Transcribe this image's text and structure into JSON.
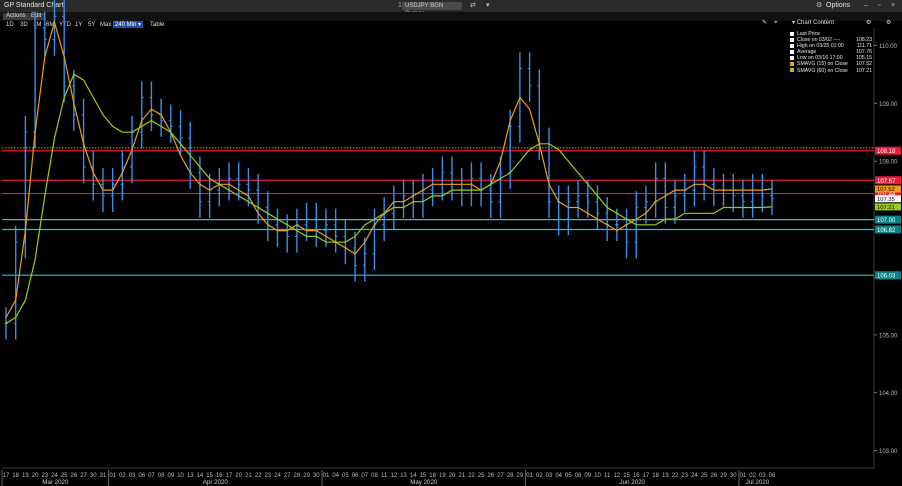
{
  "window": {
    "title": "GP Standard Chart",
    "security": "USDJPY BGN Curncy",
    "options_label": "Options",
    "window_icons": [
      "minimize-icon",
      "maximize-icon",
      "close-icon"
    ]
  },
  "toolbar": {
    "actions_label": "Actions",
    "edit_label": "Edit",
    "ranges": [
      "1D",
      "3D",
      "1M",
      "6M",
      "YTD",
      "1Y",
      "5Y",
      "Max"
    ],
    "active_range": "240 Min",
    "table_label": "Table",
    "chart_content_label": "Chart Content"
  },
  "legend": [
    {
      "label": "Last Price",
      "value": "",
      "color": "#ffffff"
    },
    {
      "label": "Close on 03/02 ----",
      "value": "108.23",
      "color": "#ffffff"
    },
    {
      "label": "High on 03/25 01:00",
      "value": "111.71",
      "color": "#ffffff"
    },
    {
      "label": "Average",
      "value": "107.76",
      "color": "#ffffff"
    },
    {
      "label": "Low on 03/16 17:00",
      "value": "105.15",
      "color": "#ffffff"
    },
    {
      "label": "SMAVG (15)  on Close",
      "value": "107.52",
      "color": "#f39c12"
    },
    {
      "label": "SMAVG (60)  on Close",
      "value": "107.21",
      "color": "#9ccc18"
    }
  ],
  "chart_data": {
    "type": "line",
    "ylim": [
      102.7,
      110.3
    ],
    "y_ticks": [
      "110.00",
      "109.00",
      "108.00",
      "107.00",
      "106.00",
      "105.00",
      "104.00",
      "103.00"
    ],
    "x_days": [
      "17",
      "18",
      "19",
      "20",
      "23",
      "24",
      "25",
      "26",
      "27",
      "30",
      "31",
      "01",
      "02",
      "03",
      "06",
      "07",
      "08",
      "09",
      "10",
      "13",
      "14",
      "15",
      "16",
      "17",
      "20",
      "21",
      "22",
      "23",
      "24",
      "27",
      "28",
      "29",
      "30",
      "01",
      "04",
      "05",
      "06",
      "07",
      "08",
      "11",
      "12",
      "13",
      "14",
      "15",
      "18",
      "19",
      "20",
      "21",
      "22",
      "25",
      "26",
      "27",
      "28",
      "29",
      "01",
      "02",
      "03",
      "04",
      "05",
      "08",
      "09",
      "10",
      "11",
      "12",
      "15",
      "16",
      "17",
      "18",
      "19",
      "22",
      "23",
      "24",
      "25",
      "26",
      "29",
      "30",
      "01",
      "02",
      "03",
      "06"
    ],
    "months": [
      {
        "label": "Mar 2020",
        "start_index": 0
      },
      {
        "label": "Apr 2020",
        "start_index": 11
      },
      {
        "label": "May 2020",
        "start_index": 33
      },
      {
        "label": "Jun 2020",
        "start_index": 54
      },
      {
        "label": "Jul 2020",
        "start_index": 76
      }
    ],
    "average_line": 108.23,
    "horizontal_lines": [
      {
        "value": 108.18,
        "label": "108.18",
        "color": "#e8193c",
        "label_bg": "#e8193c"
      },
      {
        "value": 107.67,
        "label": "107.67",
        "color": "#e8193c",
        "label_bg": "#e8193c"
      },
      {
        "value": 107.44,
        "label": "107.44",
        "color": "#e8193c",
        "label_bg": "#e8193c"
      },
      {
        "value": 106.99,
        "label": "107.00",
        "color": "#22c7c9",
        "label_bg": "#0e7f85"
      },
      {
        "value": 106.82,
        "label": "106.82",
        "color": "#22c7c9",
        "label_bg": "#0e7f85"
      },
      {
        "value": 106.03,
        "label": "106.03",
        "color": "#22c7c9",
        "label_bg": "#0e7f85"
      }
    ],
    "extra_tags": [
      {
        "value": 107.52,
        "label": "107.52",
        "bg": "#f39c12"
      },
      {
        "value": 107.21,
        "label": "107.21",
        "bg": "#9ccc18"
      },
      {
        "value": 107.35,
        "label": "107.35",
        "bg": "#ffffff"
      }
    ],
    "series": [
      {
        "name": "Last Price",
        "color": "#3a8fe8",
        "values": [
          105.2,
          106.6,
          108.5,
          110.3,
          110.1,
          110.5,
          109.3,
          108.8,
          107.9,
          107.6,
          107.4,
          107.6,
          107.9,
          108.5,
          109.1,
          108.8,
          108.7,
          108.6,
          108.4,
          107.8,
          107.3,
          107.5,
          107.6,
          107.7,
          107.6,
          107.5,
          107.2,
          106.9,
          106.8,
          106.7,
          106.9,
          107.0,
          106.8,
          106.9,
          106.7,
          106.5,
          106.2,
          106.4,
          106.9,
          107.1,
          107.3,
          107.4,
          107.3,
          107.5,
          107.6,
          107.8,
          107.6,
          107.5,
          107.7,
          107.5,
          107.3,
          107.8,
          108.6,
          109.6,
          109.3,
          108.3,
          107.3,
          107.0,
          107.3,
          107.4,
          107.3,
          107.1,
          106.9,
          106.9,
          106.6,
          107.2,
          107.3,
          107.7,
          107.2,
          107.4,
          107.5,
          107.9,
          107.6,
          107.5,
          107.5,
          107.4,
          107.3,
          107.5,
          107.4,
          107.35
        ]
      },
      {
        "name": "SMAVG (15)  on Close",
        "color": "#f39c12",
        "values": [
          105.3,
          105.6,
          106.8,
          108.5,
          109.8,
          110.4,
          109.8,
          109.0,
          108.3,
          107.8,
          107.5,
          107.5,
          107.8,
          108.2,
          108.7,
          108.9,
          108.8,
          108.5,
          108.1,
          107.8,
          107.6,
          107.5,
          107.6,
          107.6,
          107.5,
          107.4,
          107.1,
          106.9,
          106.8,
          106.8,
          106.9,
          106.8,
          106.8,
          106.7,
          106.6,
          106.5,
          106.4,
          106.6,
          106.9,
          107.1,
          107.3,
          107.3,
          107.4,
          107.5,
          107.6,
          107.6,
          107.6,
          107.6,
          107.6,
          107.5,
          107.6,
          108.0,
          108.7,
          109.1,
          108.9,
          108.3,
          107.6,
          107.3,
          107.2,
          107.2,
          107.1,
          107.0,
          106.9,
          106.8,
          106.9,
          107.0,
          107.1,
          107.3,
          107.4,
          107.5,
          107.5,
          107.6,
          107.6,
          107.5,
          107.5,
          107.5,
          107.5,
          107.5,
          107.5,
          107.52
        ]
      },
      {
        "name": "SMAVG (60)  on Close",
        "color": "#9ccc18",
        "values": [
          105.2,
          105.3,
          105.6,
          106.3,
          107.4,
          108.4,
          109.1,
          109.5,
          109.4,
          109.1,
          108.8,
          108.6,
          108.5,
          108.5,
          108.6,
          108.7,
          108.6,
          108.5,
          108.3,
          108.1,
          107.9,
          107.7,
          107.6,
          107.5,
          107.4,
          107.3,
          107.2,
          107.1,
          107.0,
          106.9,
          106.8,
          106.7,
          106.7,
          106.6,
          106.6,
          106.6,
          106.7,
          106.9,
          107.0,
          107.1,
          107.2,
          107.2,
          107.3,
          107.3,
          107.4,
          107.4,
          107.5,
          107.5,
          107.5,
          107.5,
          107.6,
          107.7,
          107.8,
          108.0,
          108.2,
          108.3,
          108.3,
          108.2,
          108.0,
          107.8,
          107.6,
          107.4,
          107.2,
          107.1,
          107.0,
          106.9,
          106.9,
          106.9,
          107.0,
          107.0,
          107.1,
          107.1,
          107.1,
          107.1,
          107.2,
          107.2,
          107.2,
          107.2,
          107.2,
          107.21
        ]
      }
    ]
  }
}
